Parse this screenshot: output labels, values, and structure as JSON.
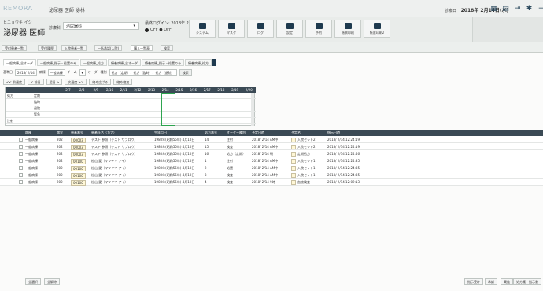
{
  "app": {
    "brand": "REMORA",
    "dept": "泌尿器 医師 泌林"
  },
  "top": {
    "date_label": "診療日",
    "date": "2018年 2月14日(水)"
  },
  "header": {
    "kana": "ヒニョウキ イシ",
    "name": "泌尿器 医師",
    "dept_label": "診療科",
    "dept_value": "泌尿器科",
    "login_text": "最終ログイン: 2018年 2月14日(水)",
    "status_text": "OFF ● OFF"
  },
  "toolbar": [
    {
      "label": "システム"
    },
    {
      "label": "マスタ"
    },
    {
      "label": "ログ"
    },
    {
      "label": "設定"
    },
    {
      "label": "予約"
    },
    {
      "label": "帳票印刷"
    },
    {
      "label": "帳票印刷2"
    }
  ],
  "main_tabs": [
    "受付患者一覧",
    "受付履歴",
    "入院患者一覧",
    "一括承認(入院)",
    "購入一覧表",
    "検索"
  ],
  "sub_tabs": [
    "一般病棟_全オーダ",
    "一般病棟_指示・処置のみ",
    "一般病棟_処方",
    "療養病棟_全オーダ",
    "療養病棟_指示・処置のみ",
    "療養病棟_処方"
  ],
  "filters": {
    "base_label": "基準日",
    "base_date": "2018/ 2/14",
    "ward_label": "病棟",
    "ward_value": "一般病棟",
    "team_label": "チーム",
    "order_label": "オーダー種別",
    "order_value": "処方（定期）、処方（臨時）、処方（退院）",
    "search": "検索"
  },
  "nav": [
    "<< 前週度",
    "< 前日",
    "翌日 >",
    "次週度 >>",
    "縮め広げる",
    "縮め縮加"
  ],
  "schedule": {
    "dates": [
      "2/7",
      "2/8",
      "2/9",
      "2/10",
      "2/11",
      "2/12",
      "2/13",
      "2/14",
      "2/15",
      "2/16",
      "2/17",
      "2/18",
      "2/19",
      "2/20"
    ],
    "rows": [
      {
        "c1": "処方",
        "c2": "定期"
      },
      {
        "c1": "",
        "c2": "臨時"
      },
      {
        "c1": "",
        "c2": "退院"
      },
      {
        "c1": "",
        "c2": "緊急"
      },
      {
        "c1": "注射",
        "c2": ""
      }
    ]
  },
  "table": {
    "headers": [
      "病棟",
      "病室",
      "患者番号",
      "患者氏名（カナ）",
      "生年月日",
      "処方番号",
      "オーダー種別",
      "予定日時",
      "予定名",
      "指示日時"
    ],
    "rows": [
      [
        "一般病棟",
        "202",
        "00003",
        "テスト 参照（テスト サブロウ）",
        "1980年(昭和55年) 4月10日",
        "14",
        "注射",
        "2018/ 2/14 AM中",
        "入院セット2",
        "2018/ 2/14 12:24:19"
      ],
      [
        "一般病棟",
        "202",
        "00003",
        "テスト 参照（テスト サブロウ）",
        "1980年(昭和55年) 4月10日",
        "15",
        "検査",
        "2018/ 2/14 AM中",
        "入院セット2",
        "2018/ 2/14 12:24:19"
      ],
      [
        "一般病棟",
        "202",
        "00003",
        "テスト 参照（テスト サブロウ）",
        "1980年(昭和55年) 4月10日",
        "16",
        "処方（定期）",
        "2018/ 2/14 朝",
        "定期処方",
        "2018/ 2/14 12:24:46"
      ],
      [
        "一般病棟",
        "202",
        "00100",
        "松山 愛（マツヤマ アイ）",
        "1980年(昭和55年) 4月10日",
        "1",
        "注射",
        "2018/ 2/14 AM中",
        "入院セット1",
        "2018/ 2/14 12:24:35"
      ],
      [
        "一般病棟",
        "202",
        "00100",
        "松山 愛（マツヤマ アイ）",
        "1980年(昭和55年) 4月10日",
        "2",
        "処置",
        "2018/ 2/14 AM中",
        "入院セット1",
        "2018/ 2/14 12:24:35"
      ],
      [
        "一般病棟",
        "202",
        "00100",
        "松山 愛（マツヤマ アイ）",
        "1980年(昭和55年) 4月10日",
        "3",
        "検査",
        "2018/ 2/14 AM中",
        "入院セット1",
        "2018/ 2/14 12:24:35"
      ],
      [
        "一般病棟",
        "202",
        "00100",
        "松山 愛（マツヤマ アイ）",
        "1980年(昭和55年) 4月10日",
        "4",
        "検査",
        "2018/ 2/14 9時",
        "血液検査",
        "2018/ 2/14 12:09:13"
      ]
    ]
  },
  "bottom": {
    "all_select": "全選択",
    "all_clear": "全解除",
    "actions": [
      "指示受け",
      "承認",
      "実施",
      "処方箋・指示書"
    ]
  }
}
